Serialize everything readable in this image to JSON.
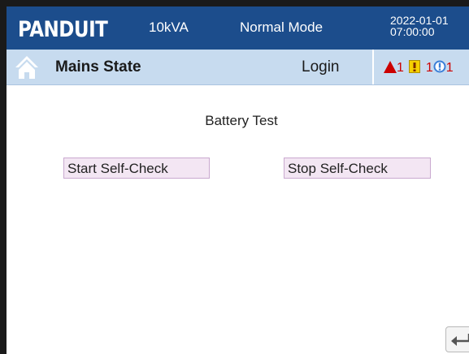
{
  "topbar": {
    "logo_text": "PANDUIT",
    "capacity": "10kVA",
    "mode": "Normal Mode",
    "date": "2022-01-01",
    "time": "07:00:00",
    "background_color": "#1c4d8c"
  },
  "navbar": {
    "home_icon": "home-icon",
    "title": "Mains State",
    "login_label": "Login",
    "background_color": "#c7dbef"
  },
  "alarms": {
    "critical_count": "1",
    "warning_count": "1",
    "info_count": "1",
    "critical_icon": "warning-triangle-icon",
    "warning_icon": "exclamation-square-icon",
    "info_icon": "info-circle-icon"
  },
  "main": {
    "section_title": "Battery Test",
    "start_button_label": "Start Self-Check",
    "stop_button_label": "Stop Self-Check",
    "button_color": "#f3e6f3"
  },
  "footer": {
    "back_icon": "back-arrow-icon"
  }
}
